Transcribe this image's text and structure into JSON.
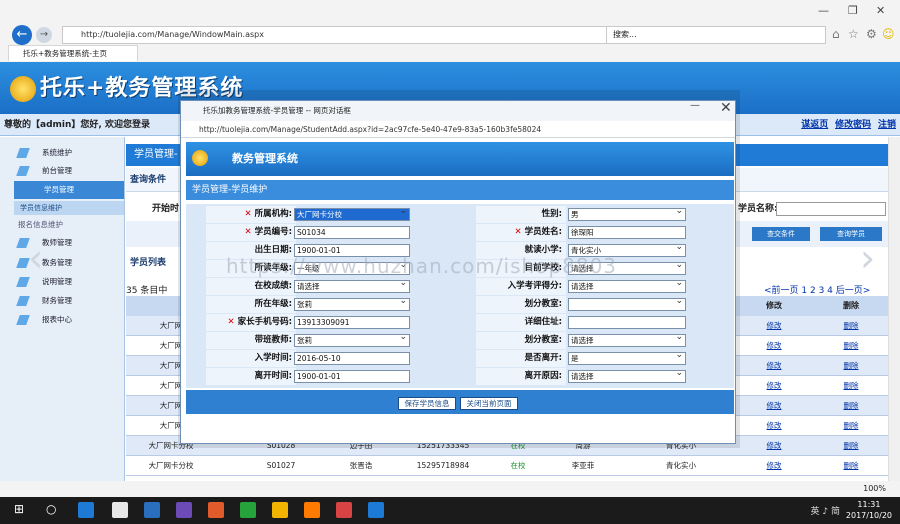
{
  "browser": {
    "url": "http://tuolejia.com/Manage/WindowMain.aspx",
    "search_placeholder": "搜索...",
    "tab_title": "托乐+教务管理系统-主页",
    "back_icon": "back-arrow-icon",
    "zoom": "100%"
  },
  "app": {
    "title": "托乐+教务管理系统",
    "welcome": "尊敬的【admin】您好, 欢迎您登录",
    "links": [
      "谋返页",
      "修改密码",
      "注销"
    ]
  },
  "sidebar": {
    "items": [
      "系统维护",
      "前台管理",
      "学员管理",
      "教师管理",
      "教务管理",
      "说明管理",
      "财务管理",
      "报表中心"
    ],
    "active_sub": "学员信息维护",
    "section_label": "报名信息维护"
  },
  "main": {
    "title": "学员管理-",
    "query_label": "查询条件",
    "start_label": "开始时",
    "name_label": "学员名称:",
    "buttons": [
      "查交条件",
      "查询学员"
    ],
    "list_title": "学员列表",
    "page_size": "35 条目中",
    "pager": "<前一页 1 2 3 4 后一页>",
    "columns": [
      "修改",
      "删除"
    ],
    "rows": [
      {
        "branch": "大厂网",
        "edit": "修改",
        "del": "删除"
      },
      {
        "branch": "大厂网",
        "edit": "修改",
        "del": "删除"
      },
      {
        "branch": "大厂网",
        "edit": "修改",
        "del": "删除"
      },
      {
        "branch": "大厂网",
        "edit": "修改",
        "del": "删除"
      },
      {
        "branch": "大厂网",
        "edit": "修改",
        "del": "删除"
      },
      {
        "branch": "大厂网",
        "edit": "修改",
        "del": "删除"
      },
      {
        "branch": "大厂网卡分校",
        "id": "S01028",
        "name": "边子田",
        "phone": "15251733345",
        "status": "在校",
        "teacher": "周游",
        "school": "青化实小",
        "edit": "修改",
        "del": "删除"
      },
      {
        "branch": "大厂网卡分校",
        "id": "S01027",
        "name": "张晋诰",
        "phone": "15295718984",
        "status": "在校",
        "teacher": "李亚菲",
        "school": "青化实小",
        "edit": "修改",
        "del": "删除"
      }
    ]
  },
  "dialog": {
    "title": "托乐加教务管理系统-学员管理 -- 网页对话框",
    "url": "http://tuolejia.com/Manage/StudentAdd.aspx?id=2ac97cfe-5e40-47e9-83a5-160b3fe58024",
    "banner": "教务管理系统",
    "section": "学员管理-学员维护",
    "left_fields": [
      {
        "label": "所属机构:",
        "value": "大厂网卡分校",
        "required": true,
        "type": "select"
      },
      {
        "label": "学员编号:",
        "value": "S01034",
        "required": true,
        "type": "text"
      },
      {
        "label": "出生日期:",
        "value": "1900-01-01",
        "required": false,
        "type": "text"
      },
      {
        "label": "所读年级:",
        "value": "一年级",
        "required": false,
        "type": "select"
      },
      {
        "label": "在校成绩:",
        "value": "请选择",
        "required": false,
        "type": "select"
      },
      {
        "label": "所在年级:",
        "value": "张莉",
        "required": false,
        "type": "select"
      },
      {
        "label": "家长手机号码:",
        "value": "13913309091",
        "required": true,
        "type": "text"
      },
      {
        "label": "带班教师:",
        "value": "张莉",
        "required": false,
        "type": "select"
      },
      {
        "label": "入学时间:",
        "value": "2016-05-10",
        "required": false,
        "type": "text"
      },
      {
        "label": "离开时间:",
        "value": "1900-01-01",
        "required": false,
        "type": "text"
      }
    ],
    "right_fields": [
      {
        "label": "性别:",
        "value": "男",
        "required": false,
        "type": "select"
      },
      {
        "label": "学员姓名:",
        "value": "徐琛阳",
        "required": true,
        "type": "text"
      },
      {
        "label": "就读小学:",
        "value": "青化实小",
        "required": false,
        "type": "select"
      },
      {
        "label": "目前学校:",
        "value": "请选择",
        "required": false,
        "type": "select"
      },
      {
        "label": "入学考评得分:",
        "value": "请选择",
        "required": false,
        "type": "select"
      },
      {
        "label": "划分教室:",
        "value": "",
        "required": false,
        "type": "select"
      },
      {
        "label": "详细住址:",
        "value": "",
        "required": false,
        "type": "text"
      },
      {
        "label": "划分教室:",
        "value": "请选择",
        "required": false,
        "type": "select"
      },
      {
        "label": "是否离开:",
        "value": "是",
        "required": false,
        "type": "select"
      },
      {
        "label": "离开原因:",
        "value": "请选择",
        "required": false,
        "type": "select"
      }
    ],
    "save_button": "保存学员信息",
    "close_button": "关闭当前页面"
  },
  "overlay": {
    "watermark": "https://www.huzhan.com/ishop8803"
  },
  "taskbar": {
    "tray": "英 ♪ 简",
    "time": "11:31",
    "date": "2017/10/20"
  }
}
